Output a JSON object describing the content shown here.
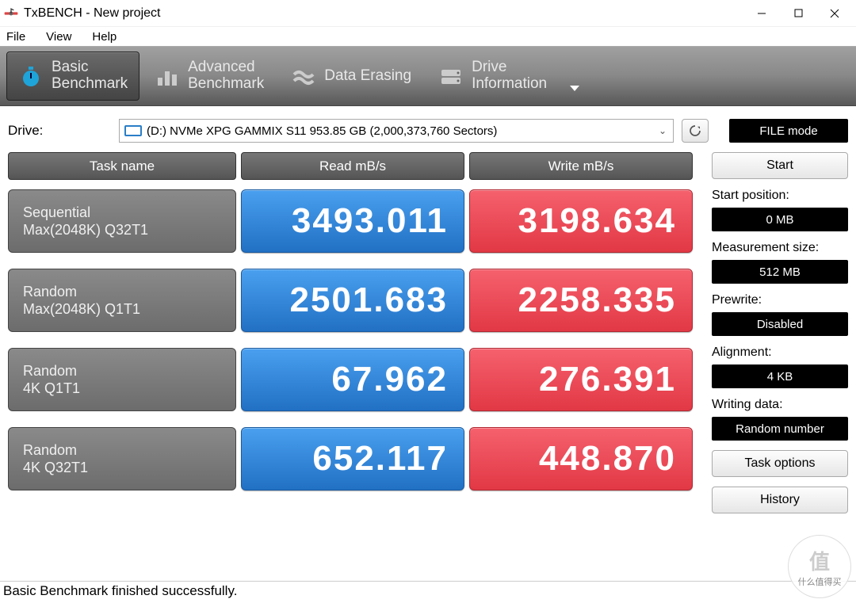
{
  "window": {
    "title": "TxBENCH - New project"
  },
  "menu": {
    "file": "File",
    "view": "View",
    "help": "Help"
  },
  "tabs": {
    "basic": "Basic\nBenchmark",
    "advanced": "Advanced\nBenchmark",
    "erasing": "Data Erasing",
    "driveinfo": "Drive\nInformation"
  },
  "drive": {
    "label": "Drive:",
    "selected": "(D:) NVMe XPG GAMMIX S11  953.85 GB (2,000,373,760 Sectors)"
  },
  "file_mode": "FILE mode",
  "headers": {
    "task": "Task name",
    "read": "Read mB/s",
    "write": "Write mB/s"
  },
  "rows": [
    {
      "name1": "Sequential",
      "name2": "Max(2048K) Q32T1",
      "read": "3493.011",
      "write": "3198.634"
    },
    {
      "name1": "Random",
      "name2": "Max(2048K) Q1T1",
      "read": "2501.683",
      "write": "2258.335"
    },
    {
      "name1": "Random",
      "name2": "4K Q1T1",
      "read": "67.962",
      "write": "276.391"
    },
    {
      "name1": "Random",
      "name2": "4K Q32T1",
      "read": "652.117",
      "write": "448.870"
    }
  ],
  "side": {
    "start": "Start",
    "start_pos_label": "Start position:",
    "start_pos_val": "0 MB",
    "meas_label": "Measurement size:",
    "meas_val": "512 MB",
    "prewrite_label": "Prewrite:",
    "prewrite_val": "Disabled",
    "align_label": "Alignment:",
    "align_val": "4 KB",
    "wdata_label": "Writing data:",
    "wdata_val": "Random number",
    "task_options": "Task options",
    "history": "History"
  },
  "status": "Basic Benchmark finished successfully.",
  "watermark": {
    "logo": "值",
    "text": "什么值得买"
  }
}
